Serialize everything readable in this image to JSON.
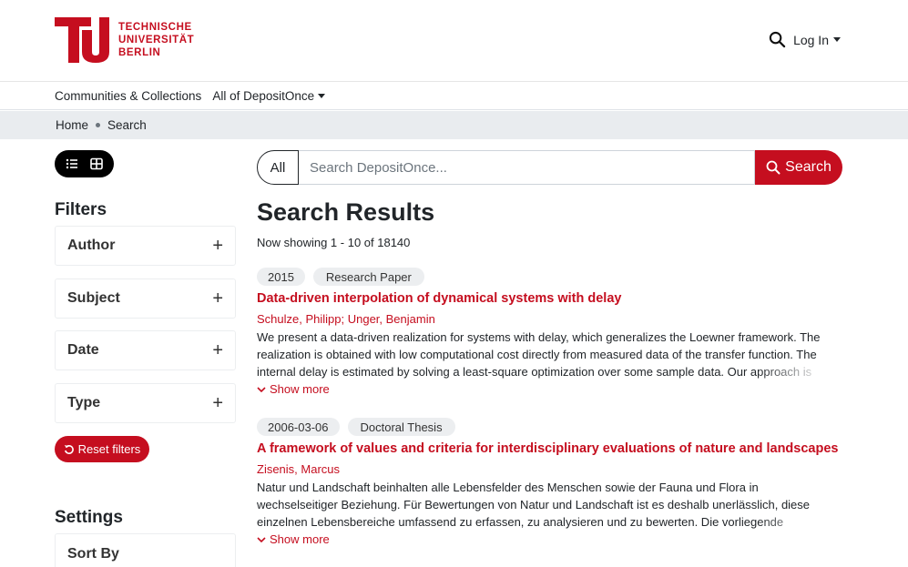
{
  "header": {
    "logo_lines": [
      "TECHNISCHE",
      "UNIVERSITÄT",
      "BERLIN"
    ],
    "login_label": "Log In",
    "brand_color": "#c50e1f"
  },
  "navbar": {
    "items": [
      {
        "label": "Communities & Collections"
      },
      {
        "label": "All of DepositOnce"
      }
    ]
  },
  "breadcrumb": {
    "home": "Home",
    "current": "Search"
  },
  "sidebar": {
    "filters_title": "Filters",
    "filters": [
      {
        "label": "Author"
      },
      {
        "label": "Subject"
      },
      {
        "label": "Date"
      },
      {
        "label": "Type"
      }
    ],
    "reset_label": "Reset filters",
    "settings_title": "Settings",
    "sort_label": "Sort By"
  },
  "search": {
    "scope_label": "All",
    "placeholder": "Search DepositOnce...",
    "button_label": "Search"
  },
  "results": {
    "title": "Search Results",
    "count_text": "Now showing 1 - 10 of 18140",
    "show_more_label": "Show more",
    "items": [
      {
        "date": "2015",
        "type": "Research Paper",
        "title": "Data-driven interpolation of dynamical systems with delay",
        "authors": "Schulze, Philipp; Unger, Benjamin",
        "abstract": "We present a data-driven realization for systems with delay, which generalizes the Loewner framework. The realization is obtained with low computational cost directly from measured data of the transfer function. The internal delay is estimated by solving a least-square optimization over some sample data. Our approach is"
      },
      {
        "date": "2006-03-06",
        "type": "Doctoral Thesis",
        "title": "A framework of values and criteria for interdisciplinary evaluations of nature and landscapes",
        "authors": "Zisenis, Marcus",
        "abstract": "Natur und Landschaft beinhalten alle Lebensfelder des Menschen sowie der Fauna und Flora in wechselseitiger Beziehung. Für Bewertungen von Natur und Landschaft ist es deshalb unerlässlich, diese einzelnen Lebensbereiche umfassend zu erfassen, zu analysieren und zu bewerten. Die vorliegende Forschungsarbeit"
      }
    ]
  }
}
